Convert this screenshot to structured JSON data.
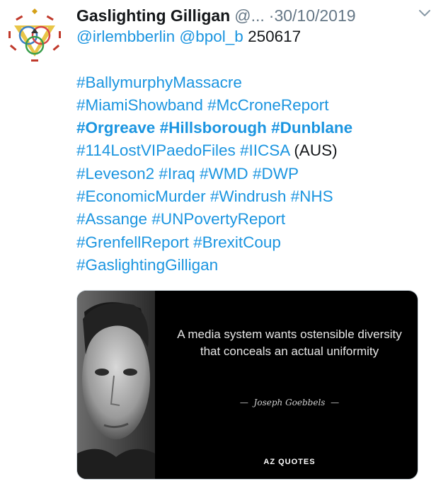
{
  "tweet": {
    "display_name": "Gaslighting Gilligan",
    "handle": "@...",
    "dot": "·",
    "date": "30/10/2019",
    "lines": [
      [
        {
          "t": "@irlembberlin",
          "s": "link"
        },
        {
          "t": " ",
          "s": "plain"
        },
        {
          "t": "@bpol_b",
          "s": "link"
        },
        {
          "t": " 250617",
          "s": "plain"
        }
      ],
      [],
      [
        {
          "t": "#BallymurphyMassacre",
          "s": "link"
        }
      ],
      [
        {
          "t": "#MiamiShowband",
          "s": "link"
        },
        {
          "t": " ",
          "s": "plain"
        },
        {
          "t": "#McCroneReport",
          "s": "link"
        }
      ],
      [
        {
          "t": "#Orgreave",
          "s": "link bold"
        },
        {
          "t": " ",
          "s": "plain"
        },
        {
          "t": "#Hillsborough",
          "s": "link bold"
        },
        {
          "t": " ",
          "s": "plain"
        },
        {
          "t": "#Dunblane",
          "s": "link bold"
        }
      ],
      [
        {
          "t": "#114LostVIPaedoFiles",
          "s": "link"
        },
        {
          "t": " ",
          "s": "plain"
        },
        {
          "t": "#IICSA",
          "s": "link"
        },
        {
          "t": " (AUS)",
          "s": "plain"
        }
      ],
      [
        {
          "t": "#Leveson2",
          "s": "link"
        },
        {
          "t": " ",
          "s": "plain"
        },
        {
          "t": "#Iraq",
          "s": "link"
        },
        {
          "t": " ",
          "s": "plain"
        },
        {
          "t": "#WMD",
          "s": "link"
        },
        {
          "t": " ",
          "s": "plain"
        },
        {
          "t": "#DWP",
          "s": "link"
        }
      ],
      [
        {
          "t": "#EconomicMurder",
          "s": "link"
        },
        {
          "t": " ",
          "s": "plain"
        },
        {
          "t": "#Windrush",
          "s": "link"
        },
        {
          "t": " ",
          "s": "plain"
        },
        {
          "t": "#NHS",
          "s": "link"
        }
      ],
      [
        {
          "t": "#Assange",
          "s": "link"
        },
        {
          "t": " ",
          "s": "plain"
        },
        {
          "t": "#UNPovertyReport",
          "s": "link"
        }
      ],
      [
        {
          "t": "#GrenfellReport",
          "s": "link"
        },
        {
          "t": " ",
          "s": "plain"
        },
        {
          "t": "#BrexitCoup",
          "s": "link"
        }
      ],
      [
        {
          "t": "#GaslightingGilligan",
          "s": "link"
        }
      ]
    ],
    "icons": {
      "avatar": "triangle-circles-logo",
      "menu": "chevron-down-icon"
    },
    "colors": {
      "link": "#1b95e0",
      "text": "#14171a",
      "muted": "#657786"
    }
  },
  "media": {
    "quote": "A media system wants ostensible diversity that conceals an actual uniformity",
    "author": "Joseph Goebbels",
    "author_dash": "—",
    "brand": "AZ QUOTES"
  }
}
